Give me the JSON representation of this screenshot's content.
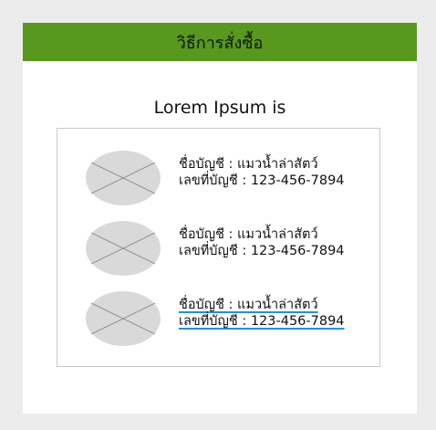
{
  "header": {
    "title": "วิธีการสั่งซื้อ",
    "background": "#58981d"
  },
  "content": {
    "subtitle": "Lorem Ipsum is"
  },
  "accounts": [
    {
      "name_line": "ชื่อบัญชี : แมวน้ำล่าสัตว์",
      "number_line": "เลขที่บัญชี : 123-456-7894",
      "icon": "image-placeholder-icon",
      "selected": false
    },
    {
      "name_line": "ชื่อบัญชี : แมวน้ำล่าสัตว์",
      "number_line": "เลขที่บัญชี : 123-456-7894",
      "icon": "image-placeholder-icon",
      "selected": false
    },
    {
      "name_line": "ชื่อบัญชี : แมวน้ำล่าสัตว์",
      "number_line": "เลขที่บัญชี : 123-456-7894",
      "icon": "image-placeholder-icon",
      "selected": true
    }
  ],
  "colors": {
    "page_background": "#ececec",
    "card_background": "#ffffff",
    "placeholder_fill": "#d9d9d9",
    "selection_underline": "#1e90e6"
  }
}
